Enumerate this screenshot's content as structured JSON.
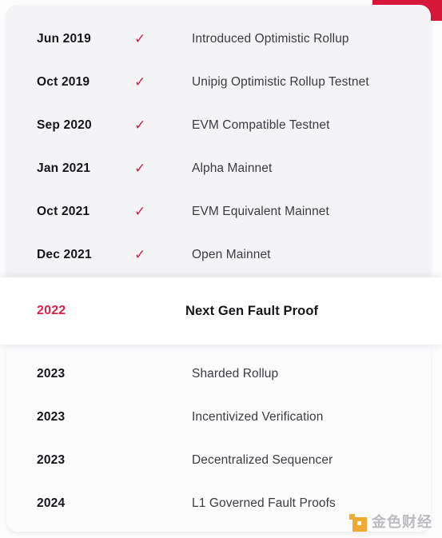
{
  "accent_colors": {
    "red": "#d6173a",
    "check": "#d81b4a",
    "highlight_year": "#e02048",
    "card_top_bg": "#f4f3f6",
    "card_bottom_bg": "#fcfcfd",
    "highlight_bg": "#ffffff",
    "text_dark": "#16161a",
    "text_body": "#3b3b42",
    "watermark_orange": "#f0a528",
    "watermark_gray": "#b9b9bd"
  },
  "timeline": {
    "completed": [
      {
        "date": "Jun 2019",
        "status_icon": "check-icon",
        "status_glyph": "✓",
        "title": "Introduced Optimistic Rollup"
      },
      {
        "date": "Oct 2019",
        "status_icon": "check-icon",
        "status_glyph": "✓",
        "title": "Unipig Optimistic Rollup Testnet"
      },
      {
        "date": "Sep 2020",
        "status_icon": "check-icon",
        "status_glyph": "✓",
        "title": "EVM Compatible Testnet"
      },
      {
        "date": "Jan 2021",
        "status_icon": "check-icon",
        "status_glyph": "✓",
        "title": "Alpha Mainnet"
      },
      {
        "date": "Oct 2021",
        "status_icon": "check-icon",
        "status_glyph": "✓",
        "title": "EVM Equivalent Mainnet"
      },
      {
        "date": "Dec 2021",
        "status_icon": "check-icon",
        "status_glyph": "✓",
        "title": "Open Mainnet"
      }
    ],
    "current": {
      "date": "2022",
      "title": "Next Gen Fault Proof"
    },
    "upcoming": [
      {
        "date": "2023",
        "title": "Sharded Rollup"
      },
      {
        "date": "2023",
        "title": "Incentivized Verification"
      },
      {
        "date": "2023",
        "title": "Decentralized Sequencer"
      },
      {
        "date": "2024",
        "title": "L1 Governed Fault Proofs"
      }
    ]
  },
  "watermark": {
    "text": "金色财经"
  }
}
